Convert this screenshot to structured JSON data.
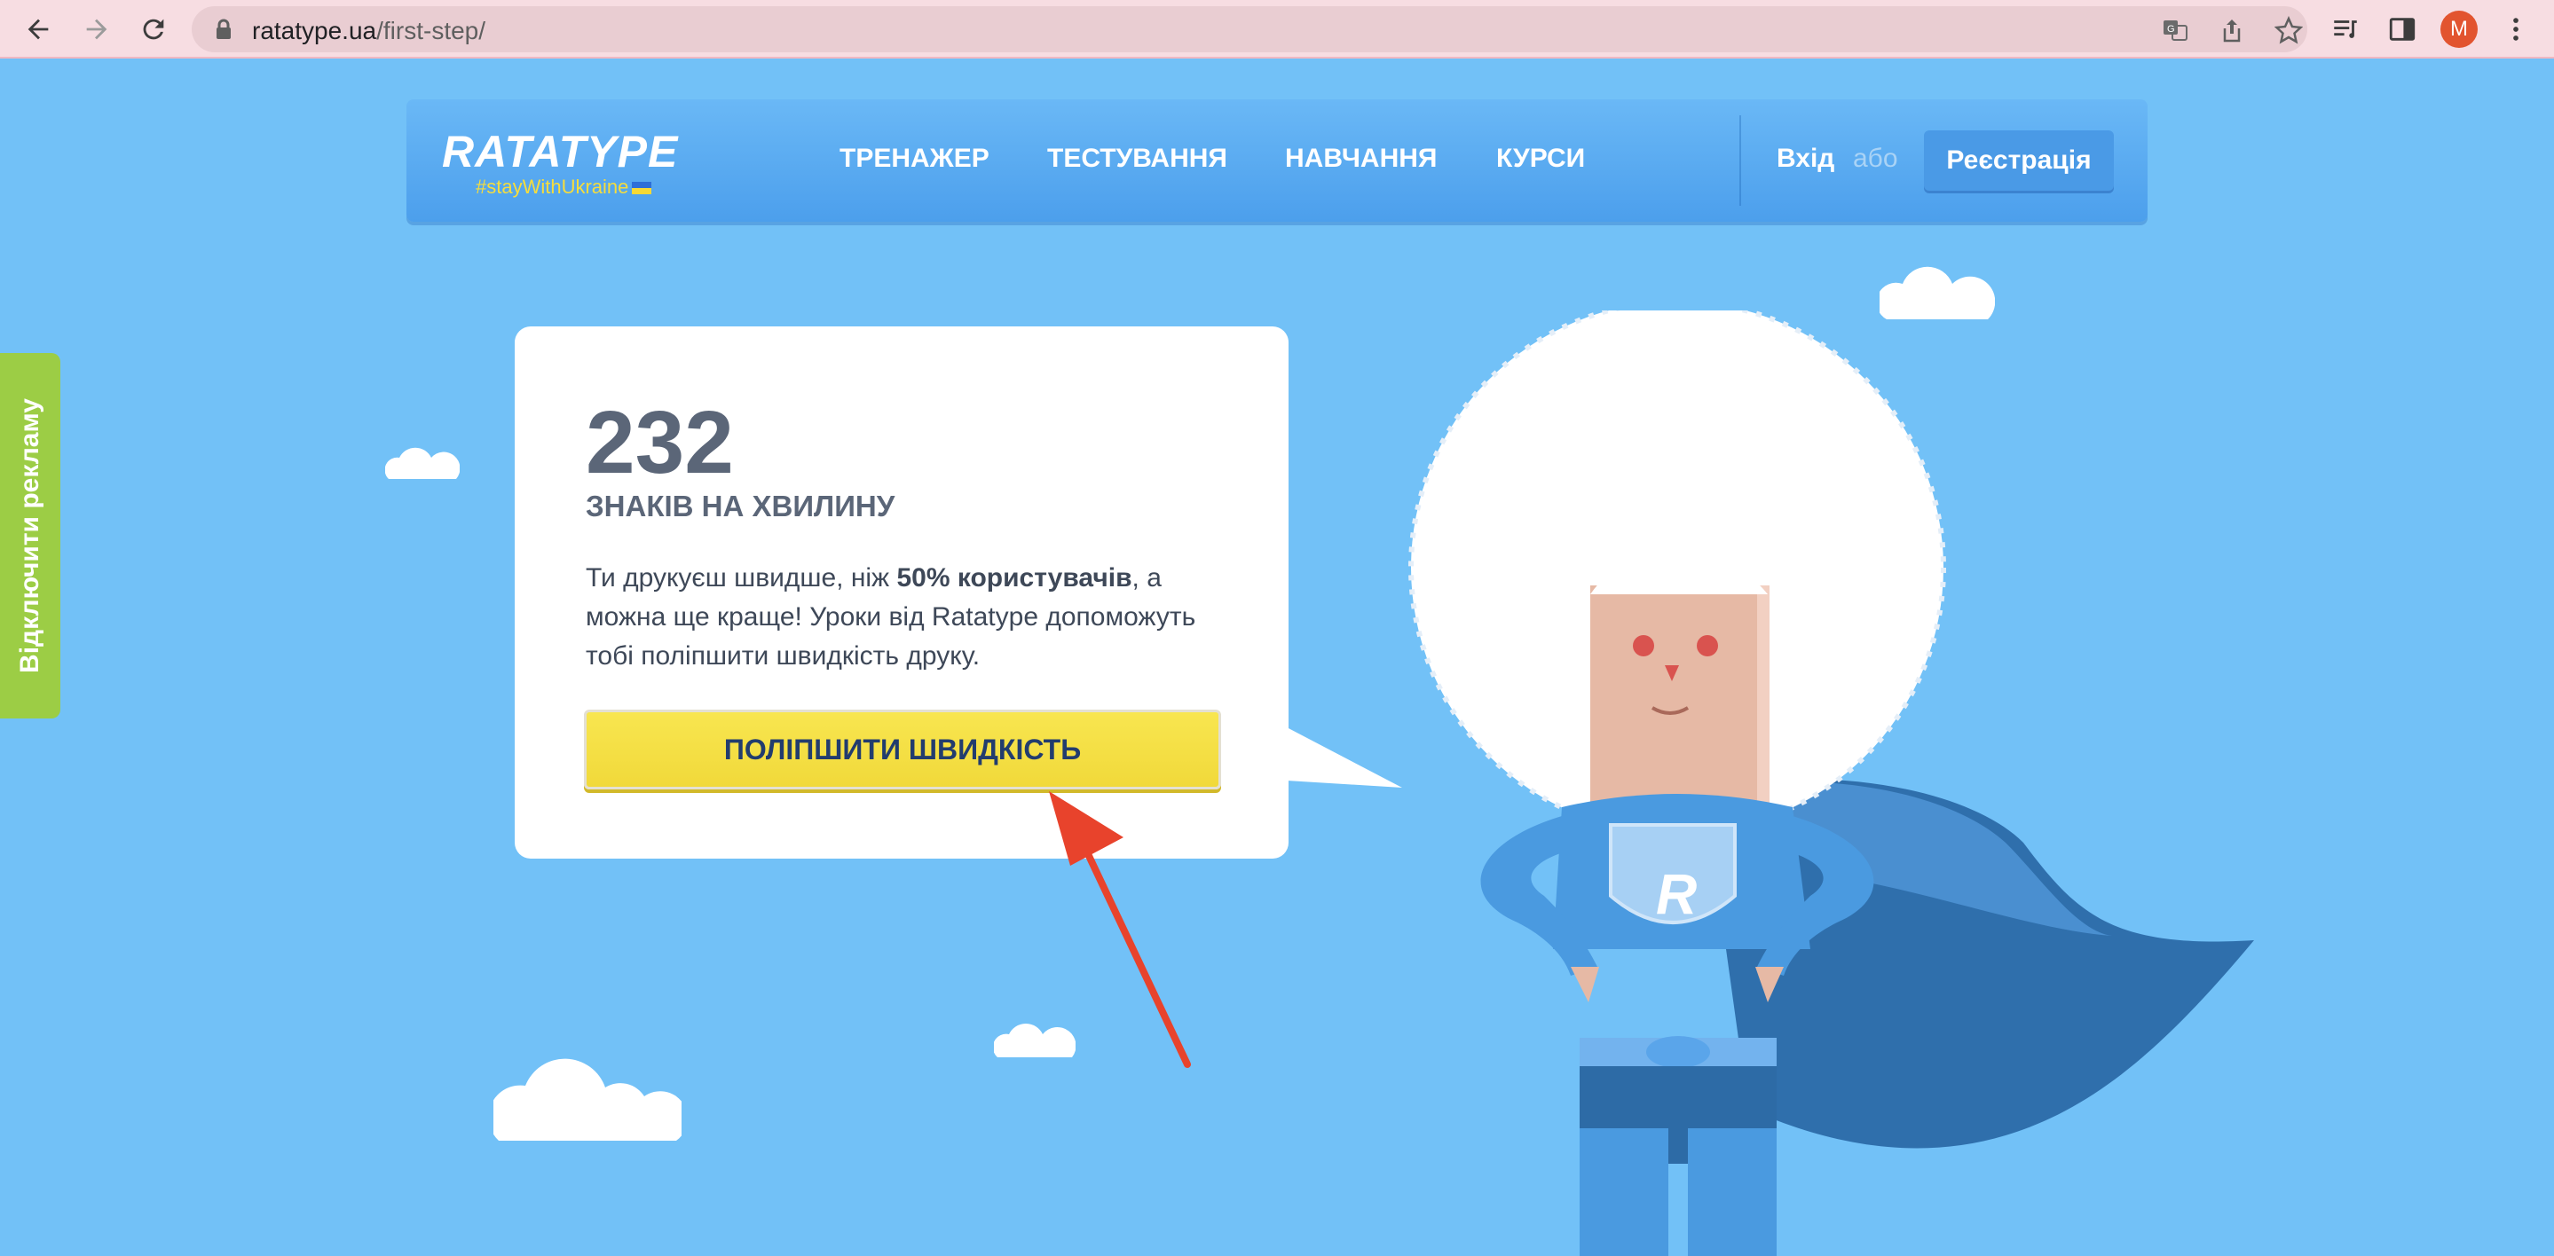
{
  "browser": {
    "url_host": "ratatype.ua",
    "url_path": "/first-step/",
    "profile_initial": "M"
  },
  "header": {
    "logo_text": "RATATYPE",
    "logo_tagline": "#stayWithUkraine",
    "nav": [
      "ТРЕНАЖЕР",
      "ТЕСТУВАННЯ",
      "НАВЧАННЯ",
      "КУРСИ"
    ],
    "login_label": "Вхід",
    "or_label": "або",
    "register_label": "Реєстрація"
  },
  "side_tab": {
    "label": "Відключити рекламу"
  },
  "result": {
    "speed": "232",
    "unit": "ЗНАКІВ НА ХВИЛИНУ",
    "desc_before": "Ти друкуєш швидше, ніж ",
    "desc_bold": "50% користувачів",
    "desc_after": ", а можна ще краще! Уроки від Ratatype допоможуть тобі поліпшити швидкість друку.",
    "button_label": "ПОЛІПШИТИ ШВИДКІСТЬ"
  },
  "mascot": {
    "chest_letter": "R"
  },
  "colors": {
    "sky": "#72c1f7",
    "header": "#4c9fec",
    "button_yellow": "#f1d93a",
    "side_tab_green": "#9ccd45",
    "arrow_red": "#e8432c"
  }
}
